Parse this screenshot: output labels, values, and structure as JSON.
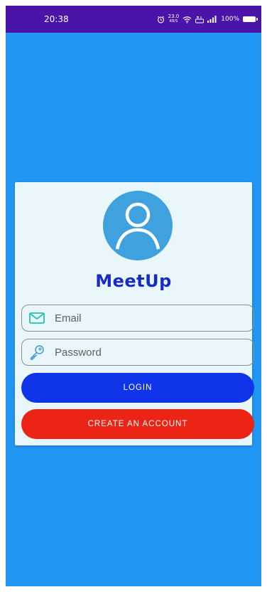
{
  "status_bar": {
    "time": "20:38",
    "speed_value": "23.0",
    "speed_unit": "KB/S",
    "battery": "100%"
  },
  "app": {
    "title": "MeetUp"
  },
  "form": {
    "email_placeholder": "Email",
    "password_placeholder": "Password",
    "login_label": "LOGIN",
    "create_account_label": "CREATE AN ACCOUNT"
  },
  "colors": {
    "background": "#2196F3",
    "status_bar": "#4A14A8",
    "card": "#E9F7FA",
    "title": "#1A2BC4",
    "login_button": "#1034E8",
    "create_button": "#EC2416",
    "avatar": "#3FA2DE"
  },
  "icons": {
    "email": "envelope-icon",
    "password": "key-icon",
    "avatar": "user-icon"
  }
}
